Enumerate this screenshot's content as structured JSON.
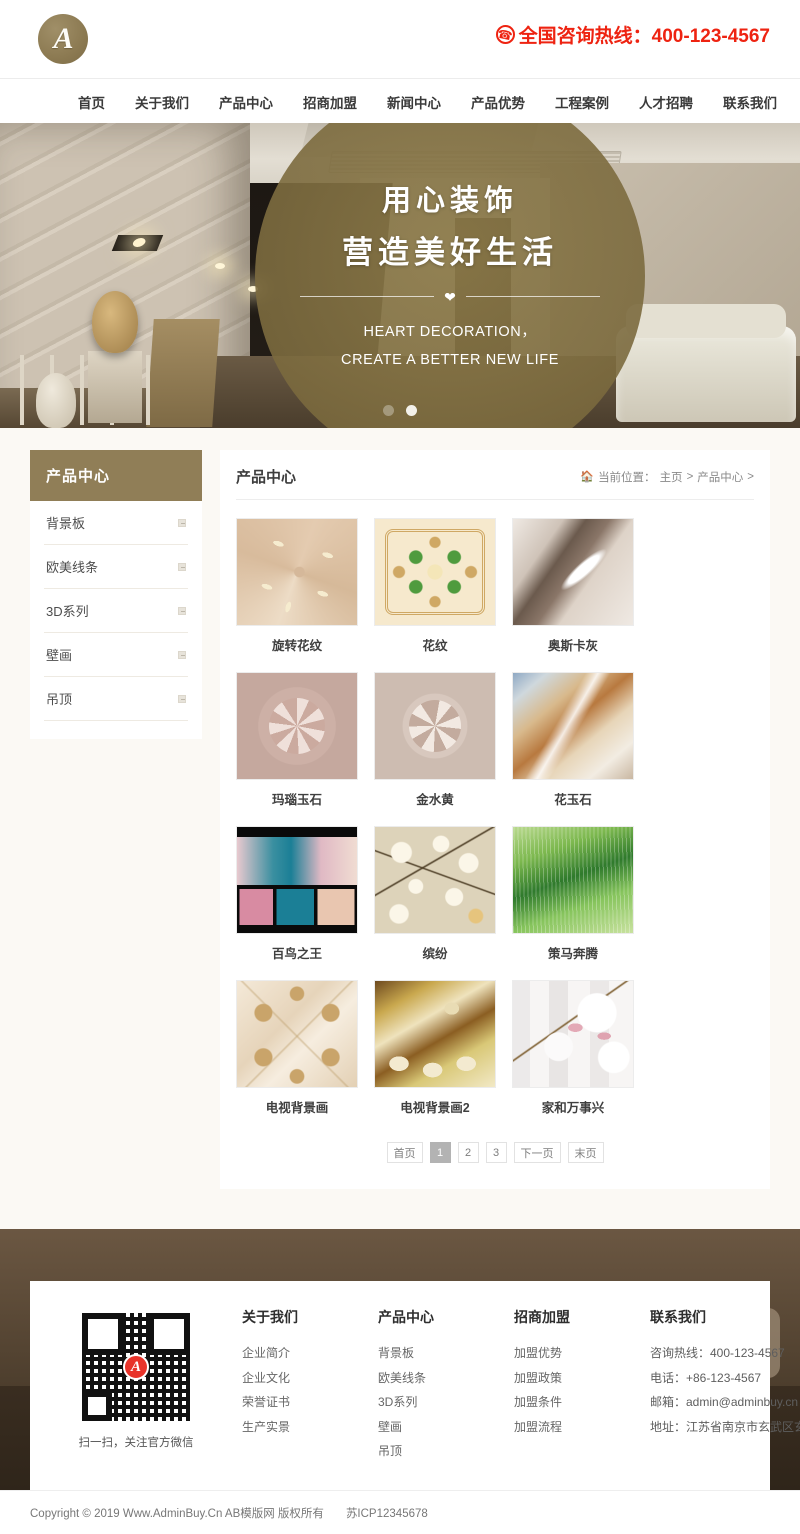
{
  "header": {
    "logo_letter": "A",
    "hotline_label": "全国咨询热线：400-123-4567",
    "phone_icon": "phone-icon"
  },
  "nav": {
    "items": [
      {
        "label": "首页"
      },
      {
        "label": "关于我们"
      },
      {
        "label": "产品中心"
      },
      {
        "label": "招商加盟"
      },
      {
        "label": "新闻中心"
      },
      {
        "label": "产品优势"
      },
      {
        "label": "工程案例"
      },
      {
        "label": "人才招聘"
      },
      {
        "label": "联系我们"
      }
    ]
  },
  "hero": {
    "line1": "用心装饰",
    "line2": "营造美好生活",
    "heart_icon": "heart-icon",
    "english_line1": "HEART DECORATION，",
    "english_line2": "CREATE A BETTER NEW LIFE",
    "dots": [
      {
        "active": false
      },
      {
        "active": true
      }
    ]
  },
  "sidebar": {
    "title": "产品中心",
    "items": [
      {
        "label": "背景板"
      },
      {
        "label": "欧美线条"
      },
      {
        "label": "3D系列"
      },
      {
        "label": "壁画"
      },
      {
        "label": "吊顶"
      }
    ]
  },
  "content": {
    "title": "产品中心",
    "home_icon": "home-icon",
    "breadcrumb_prefix": "当前位置：",
    "breadcrumb_home": "主页",
    "breadcrumb_sep1": ">",
    "breadcrumb_current": "产品中心",
    "breadcrumb_sep2": ">",
    "products": [
      {
        "name": "旋转花纹",
        "tex": "t1"
      },
      {
        "name": "花纹",
        "tex": "t2"
      },
      {
        "name": "奥斯卡灰",
        "tex": "t3"
      },
      {
        "name": "玛瑙玉石",
        "tex": "t4"
      },
      {
        "name": "金水黄",
        "tex": "t5"
      },
      {
        "name": "花玉石",
        "tex": "t6"
      },
      {
        "name": "百鸟之王",
        "tex": "t7"
      },
      {
        "name": "缤纷",
        "tex": "t8"
      },
      {
        "name": "策马奔腾",
        "tex": "t9"
      },
      {
        "name": "电视背景画",
        "tex": "t10"
      },
      {
        "name": "电视背景画2",
        "tex": "t11"
      },
      {
        "name": "家和万事兴",
        "tex": "t12"
      }
    ],
    "pagination": [
      {
        "label": "首页",
        "active": false
      },
      {
        "label": "1",
        "active": true
      },
      {
        "label": "2",
        "active": false
      },
      {
        "label": "3",
        "active": false
      },
      {
        "label": "下一页",
        "active": false
      },
      {
        "label": "末页",
        "active": false
      }
    ]
  },
  "footer": {
    "qr_caption": "扫一扫，关注官方微信",
    "qr_logo_letter": "A",
    "col_about": {
      "title": "关于我们",
      "items": [
        {
          "label": "企业简介"
        },
        {
          "label": "企业文化"
        },
        {
          "label": "荣誉证书"
        },
        {
          "label": "生产实景"
        }
      ]
    },
    "col_products": {
      "title": "产品中心",
      "items": [
        {
          "label": "背景板"
        },
        {
          "label": "欧美线条"
        },
        {
          "label": "3D系列"
        },
        {
          "label": "壁画"
        },
        {
          "label": "吊顶"
        }
      ]
    },
    "col_join": {
      "title": "招商加盟",
      "items": [
        {
          "label": "加盟优势"
        },
        {
          "label": "加盟政策"
        },
        {
          "label": "加盟条件"
        },
        {
          "label": "加盟流程"
        }
      ]
    },
    "col_contact": {
      "title": "联系我们",
      "items": [
        {
          "label": "咨询热线：400-123-4567"
        },
        {
          "label": "电话：+86-123-4567"
        },
        {
          "label": "邮箱：admin@adminbuy.cn"
        },
        {
          "label": "地址：江苏省南京市玄武区玄武湖"
        }
      ]
    }
  },
  "copyright": {
    "text": "Copyright © 2019 Www.AdminBuy.Cn AB模版网 版权所有",
    "icp": "苏ICP12345678"
  },
  "colors": {
    "brand": "#907e57",
    "hotline_red": "#ee2311",
    "page_bg": "#fbf9f4"
  }
}
